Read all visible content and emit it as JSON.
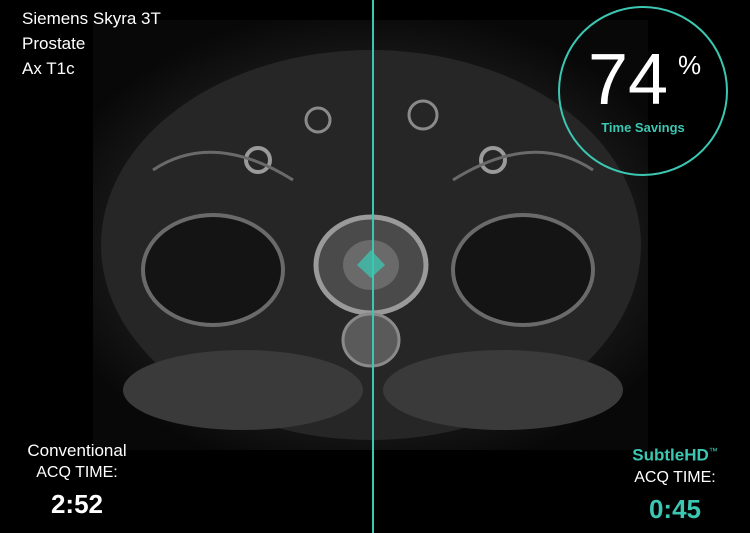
{
  "scan_info": {
    "scanner": "Siemens Skyra 3T",
    "region": "Prostate",
    "sequence": "Ax T1c"
  },
  "savings": {
    "value": "74",
    "unit": "%",
    "label": "Time Savings"
  },
  "conventional": {
    "title": "Conventional",
    "acq_label": "ACQ TIME:",
    "time": "2:52"
  },
  "subtle": {
    "title": "SubtleHD",
    "trademark": "™",
    "acq_label": "ACQ TIME:",
    "time": "0:45"
  },
  "colors": {
    "accent": "#3cc7b2"
  }
}
